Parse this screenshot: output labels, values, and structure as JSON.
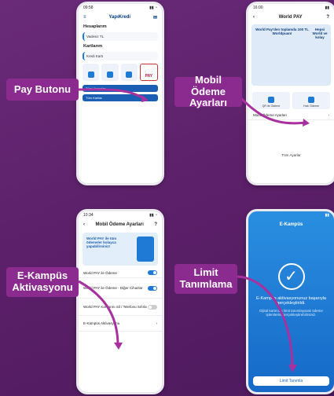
{
  "labels": {
    "pay_button": "Pay Butonu",
    "mobile_payment_settings": "Mobil Ödeme\nAyarları",
    "ekampus_activation": "E-Kampüs\nAktivasyonu",
    "limit_definition": "Limit\nTanımlama"
  },
  "phone1": {
    "time": "09:58",
    "brand": "YapıKredi",
    "accounts_title": "Hesaplarım",
    "account_name": "Vadesiz TL",
    "cards_title": "Kartlarım",
    "card_name": "Kredi Kartı",
    "pay_label": "PAY",
    "bar1": "Tüm Hesaplar",
    "bar2": "Tüm Kartlar"
  },
  "phone2": {
    "time": "16:00",
    "title": "World PAY",
    "promo": "World Pay'den toplamda 100 TL Worldpuan!",
    "promo2": "Hepsi World ve kolay",
    "tile1": "QR ile Ödeme",
    "tile2": "Hızlı Ödeme",
    "settings_row": "Mobil Ödeme Ayarları",
    "footer": "Tüm Ayarlar"
  },
  "phone3": {
    "time": "10:34",
    "title": "Mobil Ödeme Ayarları",
    "banner": "World PAY ile tüm ödemeler kolayca yapabilirsiniz!",
    "opt1": "World PAY ile Ödeme",
    "opt2": "World PAY ile Ödeme - Diğer Cihazlar",
    "opt3": "World PAY Kartlarını Sil / Telefonu Sıfırla",
    "opt4": "E-Kampüs Aktivasyonu"
  },
  "phone4": {
    "title": "E-Kampüs",
    "message": "E-Kampüs aktivasyonunuz başarıyla gerçekleştirildi.",
    "sub": "Dijital kartınıza limit tanımlayarak ödeme işlemlerini gerçekleştirebilirsiniz.",
    "button": "Limit Tanımla"
  },
  "colors": {
    "label_bg": "#8b2a8f",
    "accent": "#1f7ad6",
    "background": "#5a1f68"
  }
}
